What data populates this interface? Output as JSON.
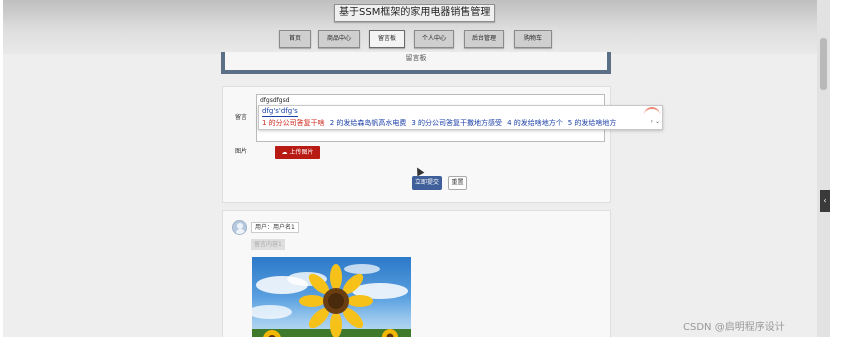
{
  "site": {
    "title": "基于SSM框架的家用电器销售管理"
  },
  "nav": {
    "items": [
      {
        "label": "首页"
      },
      {
        "label": "商品中心"
      },
      {
        "label": "留言板"
      },
      {
        "label": "个人中心"
      },
      {
        "label": "后台管理"
      },
      {
        "label": "购物车"
      }
    ],
    "active": "留言板"
  },
  "board": {
    "title": "留言板"
  },
  "form": {
    "message_label": "留言",
    "typed_text": "dfgsdfgsd",
    "image_label": "图片",
    "upload_label": "上传图片",
    "submit_label": "立即提交",
    "reset_label": "重置"
  },
  "ime": {
    "composition": "dfg's'dfg's",
    "candidates": [
      "1 的分公司答复干啥",
      "2 的发给森岛帆高水电费",
      "3 的分公司答复干撒地方感受",
      "4 的发给啥地方个",
      "5 的发给啥地方"
    ],
    "nav_glyph": "› ⌄"
  },
  "post": {
    "user_label": "用户：用户名1",
    "reply_label": "留言内容1"
  },
  "side_tab": {
    "glyph": "‹"
  },
  "watermark": "CSDN @启明程序设计",
  "colors": {
    "upload": "#b81b14",
    "submit": "#3e5f99",
    "panel_border": "#5b6f86",
    "ime_text": "#1a3fa8",
    "ime_first": "#d0281e"
  }
}
